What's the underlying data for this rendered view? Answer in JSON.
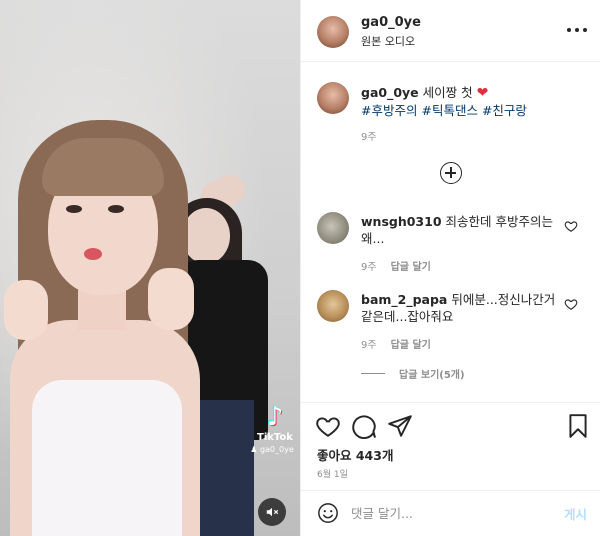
{
  "media": {
    "watermark": {
      "brand": "TikTok",
      "handle": "ga0_0ye"
    },
    "icons": {
      "watermark": "tiktok-logo-icon",
      "mute": "speaker-muted-icon"
    }
  },
  "header": {
    "username": "ga0_0ye",
    "audio": "원본 오디오",
    "icons": {
      "more": "more-options-icon"
    }
  },
  "caption": {
    "username": "ga0_0ye",
    "text": "세이짱 첫",
    "emoji": "❤",
    "hashtags": [
      "#후방주의",
      "#틱톡댄스",
      "#친구랑"
    ],
    "time": "9주"
  },
  "comments": [
    {
      "username": "wnsgh0310",
      "text": "죄송한데 후방주의는 왜...",
      "time": "9주",
      "reply_label": "답글 달기"
    },
    {
      "username": "bam_2_papa",
      "text": "뒤에분...정신나간거 같은데...잡아줘요",
      "time": "9주",
      "reply_label": "답글 달기"
    }
  ],
  "view_replies": "답글 보기(5개)",
  "actions": {
    "likes": "좋아요 443개",
    "date": "6월 1일",
    "icons": [
      "heart-icon",
      "comment-icon",
      "share-icon",
      "bookmark-icon"
    ]
  },
  "comment_box": {
    "placeholder": "댓글 달기...",
    "post_label": "게시",
    "icons": {
      "emoji": "emoji-smile-icon"
    }
  },
  "colors": {
    "link": "#00376b",
    "heart": "#e02f3d",
    "muted_text": "#8e8e8e",
    "post_disabled": "#b2dffc"
  }
}
